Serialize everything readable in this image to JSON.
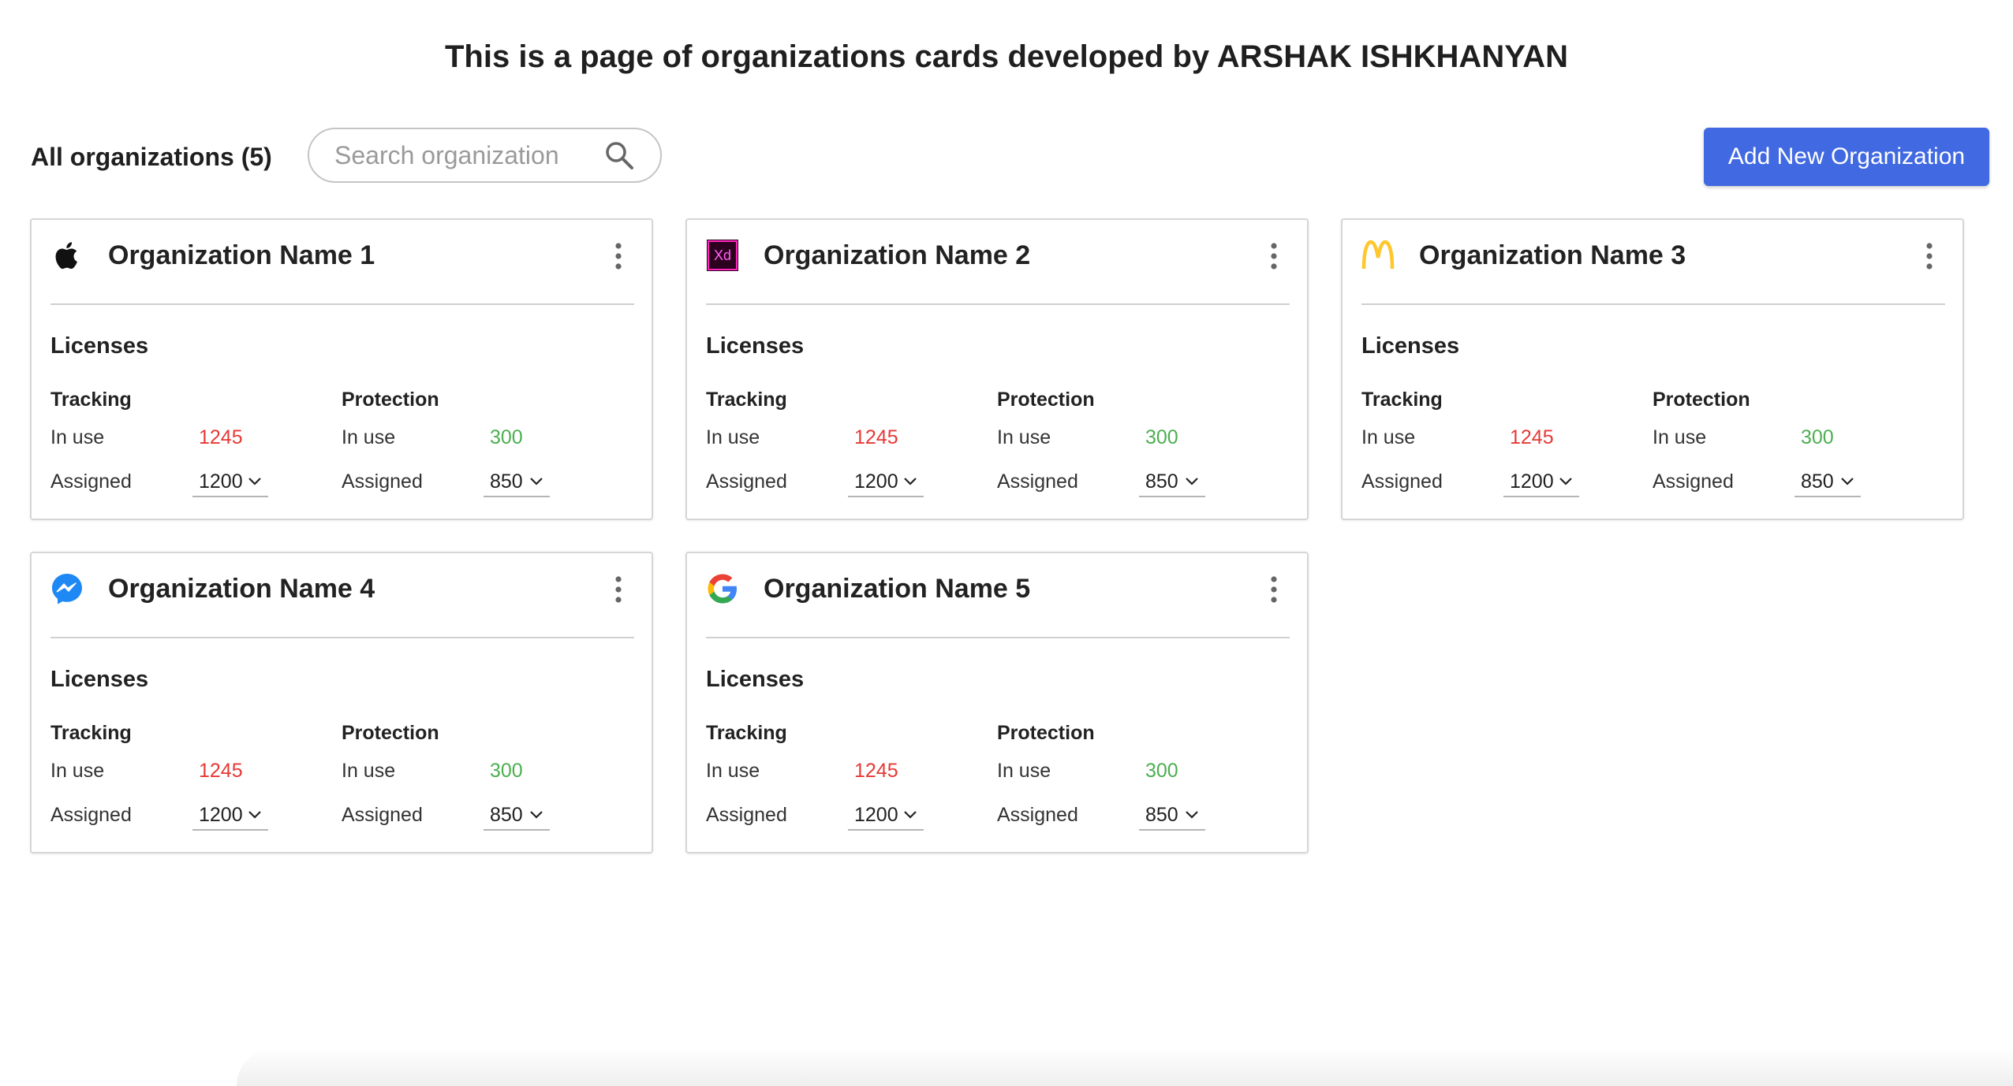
{
  "header": {
    "title": "This is a page of organizations cards developed by ARSHAK ISHKHANYAN"
  },
  "toolbar": {
    "all_label": "All organizations (5)",
    "search_placeholder": "Search organization",
    "search_value": "",
    "search_icon": "search-icon",
    "add_button_label": "Add New Organization"
  },
  "colors": {
    "accent": "#4169e1",
    "tracking_in_use": "#e53935",
    "protection_in_use": "#4caf50"
  },
  "organizations": [
    {
      "name": "Organization Name 1",
      "logo": "apple-logo",
      "licenses_label": "Licenses",
      "tracking": {
        "title": "Tracking",
        "in_use_label": "In use",
        "in_use": "1245",
        "assigned_label": "Assigned",
        "assigned": "1200"
      },
      "protection": {
        "title": "Protection",
        "in_use_label": "In use",
        "in_use": "300",
        "assigned_label": "Assigned",
        "assigned": "850"
      }
    },
    {
      "name": "Organization Name 2",
      "logo": "adobe-xd-logo",
      "logo_text": "Xd",
      "licenses_label": "Licenses",
      "tracking": {
        "title": "Tracking",
        "in_use_label": "In use",
        "in_use": "1245",
        "assigned_label": "Assigned",
        "assigned": "1200"
      },
      "protection": {
        "title": "Protection",
        "in_use_label": "In use",
        "in_use": "300",
        "assigned_label": "Assigned",
        "assigned": "850"
      }
    },
    {
      "name": "Organization Name 3",
      "logo": "mcdonalds-logo",
      "licenses_label": "Licenses",
      "tracking": {
        "title": "Tracking",
        "in_use_label": "In use",
        "in_use": "1245",
        "assigned_label": "Assigned",
        "assigned": "1200"
      },
      "protection": {
        "title": "Protection",
        "in_use_label": "In use",
        "in_use": "300",
        "assigned_label": "Assigned",
        "assigned": "850"
      }
    },
    {
      "name": "Organization Name 4",
      "logo": "messenger-logo",
      "licenses_label": "Licenses",
      "tracking": {
        "title": "Tracking",
        "in_use_label": "In use",
        "in_use": "1245",
        "assigned_label": "Assigned",
        "assigned": "1200"
      },
      "protection": {
        "title": "Protection",
        "in_use_label": "In use",
        "in_use": "300",
        "assigned_label": "Assigned",
        "assigned": "850"
      }
    },
    {
      "name": "Organization Name 5",
      "logo": "google-logo",
      "licenses_label": "Licenses",
      "tracking": {
        "title": "Tracking",
        "in_use_label": "In use",
        "in_use": "1245",
        "assigned_label": "Assigned",
        "assigned": "1200"
      },
      "protection": {
        "title": "Protection",
        "in_use_label": "In use",
        "in_use": "300",
        "assigned_label": "Assigned",
        "assigned": "850"
      }
    }
  ]
}
